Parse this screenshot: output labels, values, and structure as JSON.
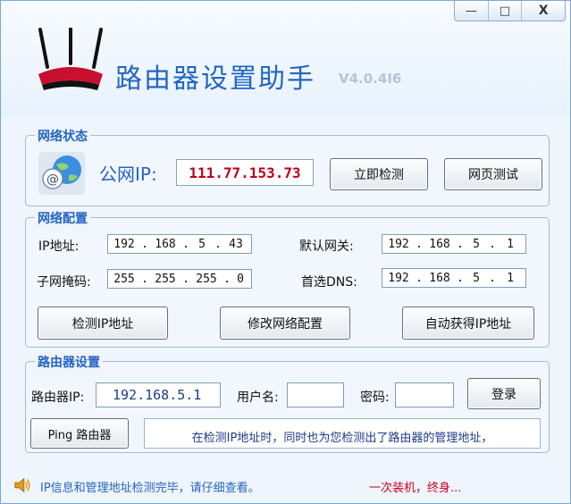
{
  "window": {
    "minimize": "—",
    "maximize": "□",
    "close": "X"
  },
  "header": {
    "title": "路由器设置助手",
    "version": "V4.0.4I6"
  },
  "network_status": {
    "title": "网络状态",
    "public_ip_label": "公网IP:",
    "public_ip_value": "111.77.153.73",
    "check_now_button": "立即检测",
    "web_test_button": "网页测试"
  },
  "network_config": {
    "title": "网络配置",
    "ip_label": "IP地址:",
    "ip": [
      "192",
      "168",
      "5",
      "43"
    ],
    "gateway_label": "默认网关:",
    "gateway": [
      "192",
      "168",
      "5",
      "1"
    ],
    "mask_label": "子网掩码:",
    "mask": [
      "255",
      "255",
      "255",
      "0"
    ],
    "dns_label": "首选DNS:",
    "dns": [
      "192",
      "168",
      "5",
      "1"
    ],
    "detect_ip_button": "检测IP地址",
    "modify_button": "修改网络配置",
    "auto_ip_button": "自动获得IP地址"
  },
  "router_settings": {
    "title": "路由器设置",
    "router_ip_label": "路由器IP:",
    "router_ip_value": "192.168.5.1",
    "username_label": "用户名:",
    "username_value": "",
    "password_label": "密码:",
    "password_value": "",
    "login_button": "登录",
    "ping_button": "Ping 路由器",
    "message": "在检测IP地址时，同时也为您检测出了路由器的管理地址，"
  },
  "status": {
    "message": "IP信息和管理地址检测完毕，请仔细查看。",
    "slogan": "一次装机，终身..."
  },
  "colors": {
    "accent": "#2563c3",
    "public_ip": "#c0001a",
    "slogan": "#d0001a"
  },
  "icons": {
    "speaker": "speaker-icon",
    "globe": "globe-email-icon",
    "router": "router-icon"
  }
}
